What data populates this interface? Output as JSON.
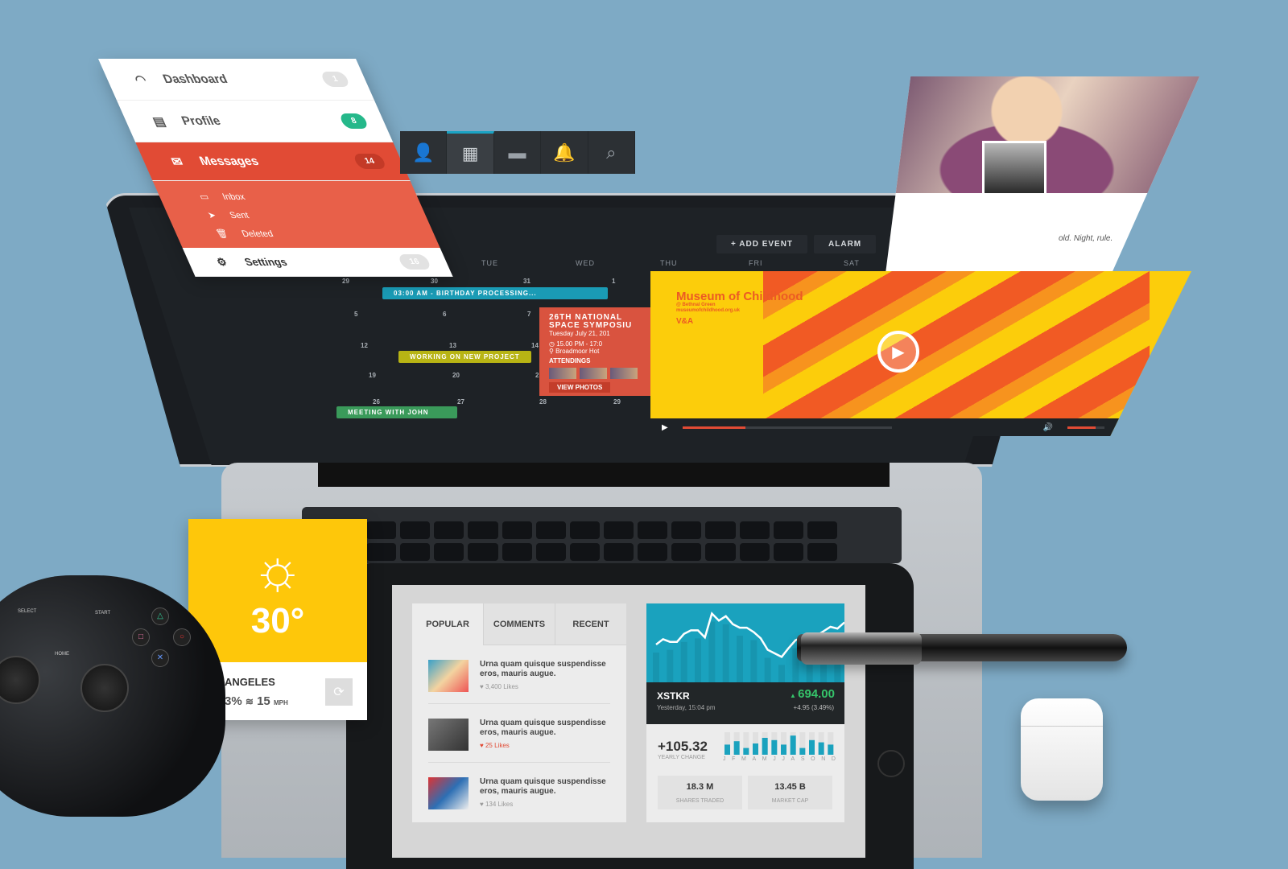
{
  "sidebar": {
    "items": [
      {
        "label": "Dashboard",
        "icon": "gauge-icon",
        "badge": "1",
        "badge_color": "#e2e2e2"
      },
      {
        "label": "Profile",
        "icon": "id-card-icon",
        "badge": "8",
        "badge_color": "#25b88a"
      },
      {
        "label": "Messages",
        "icon": "envelope-icon",
        "badge": "14",
        "badge_color": "#c43a27",
        "active": true
      },
      {
        "label": "Settings",
        "icon": "gear-icon",
        "badge": "16",
        "badge_color": "#e2e2e2"
      }
    ],
    "subitems": [
      {
        "label": "Inbox",
        "icon": "inbox-icon"
      },
      {
        "label": "Sent",
        "icon": "paper-plane-icon"
      },
      {
        "label": "Deleted",
        "icon": "trash-icon"
      }
    ]
  },
  "toolbar": {
    "icons": [
      "user-icon",
      "calendar-icon",
      "chat-icon",
      "bell-icon",
      "search-icon"
    ],
    "active": "calendar-icon"
  },
  "calendar": {
    "add_event": "+   ADD EVENT",
    "alarm": "ALARM",
    "weekdays": [
      "ON",
      "TUE",
      "WED",
      "THU",
      "FRI",
      "SAT"
    ],
    "weeks": [
      [
        "29",
        "30",
        "31",
        "1"
      ],
      [
        "5",
        "6",
        "7"
      ],
      [
        "12",
        "13",
        "14"
      ],
      [
        "19",
        "20",
        "21"
      ],
      [
        "26",
        "27",
        "28",
        "29"
      ]
    ],
    "events": [
      {
        "label": "03:00 AM - BIRTHDAY PROCESSING...",
        "color": "#1a9bb5"
      },
      {
        "label": "WORKING ON NEW PROJECT",
        "color": "#b8b414"
      },
      {
        "label": "MEETING WITH JOHN",
        "color": "#3a9a5a"
      }
    ],
    "popup": {
      "title": "26TH NATIONAL SPACE SYMPOSIU",
      "date": "Tuesday July 21, 201",
      "time": "15.00 PM - 17:0",
      "place": "Broadmoor Hot",
      "attendings": "ATTENDINGS",
      "button": "VIEW PHOTOS",
      "color": "#d9533f"
    }
  },
  "photo_card": {
    "text": "old. Night, rule."
  },
  "video": {
    "logo": "Museum of Childhood",
    "logo_sub": "@ Bethnal Green",
    "logo_url": "museumofchildhood.org.uk",
    "logo_mark": "V&A",
    "progress": 0.3,
    "volume": 0.75,
    "accent": "#e14b35"
  },
  "weather": {
    "temp": "30°",
    "city": "ANGELES",
    "humidity": "3%",
    "wind": "15",
    "wind_unit": "MPH",
    "icon": "sun-icon",
    "color": "#fec70a"
  },
  "gamepad": {
    "select": "SELECT",
    "start": "START",
    "home": "HOME"
  },
  "posts": {
    "tabs": [
      "POPULAR",
      "COMMENTS",
      "RECENT"
    ],
    "active_tab": "POPULAR",
    "items": [
      {
        "title": "Urna quam quisque suspendisse eros, mauris augue.",
        "likes": "3,400 Likes",
        "liked": false
      },
      {
        "title": "Urna quam quisque suspendisse eros, mauris augue.",
        "likes": "25 Likes",
        "liked": true
      },
      {
        "title": "Urna quam quisque suspendisse eros, mauris augue.",
        "likes": "134 Likes",
        "liked": false
      }
    ]
  },
  "stock": {
    "symbol": "XSTKR",
    "when": "Yesterday, 15:04 pm",
    "price": "694.00",
    "change": "+4.95 (3.49%)",
    "yearly": "+105.32",
    "yearly_label": "YEARLY CHANGE",
    "shares": "18.3 M",
    "shares_label": "SHARES TRADED",
    "cap": "13.45 B",
    "cap_label": "MARKET CAP",
    "up_color": "#35c46a",
    "chart_color": "#1aa2be",
    "line": [
      40,
      46,
      43,
      43,
      52,
      56,
      56,
      48,
      75,
      67,
      72,
      63,
      59,
      59,
      54,
      47,
      34,
      30,
      26,
      36,
      45,
      48,
      45,
      50,
      55,
      60,
      58,
      65
    ],
    "months": [
      "J",
      "F",
      "M",
      "A",
      "M",
      "J",
      "J",
      "A",
      "S",
      "O",
      "N",
      "D"
    ],
    "monthly": [
      45,
      60,
      30,
      50,
      75,
      65,
      45,
      85,
      30,
      65,
      55,
      45
    ]
  }
}
